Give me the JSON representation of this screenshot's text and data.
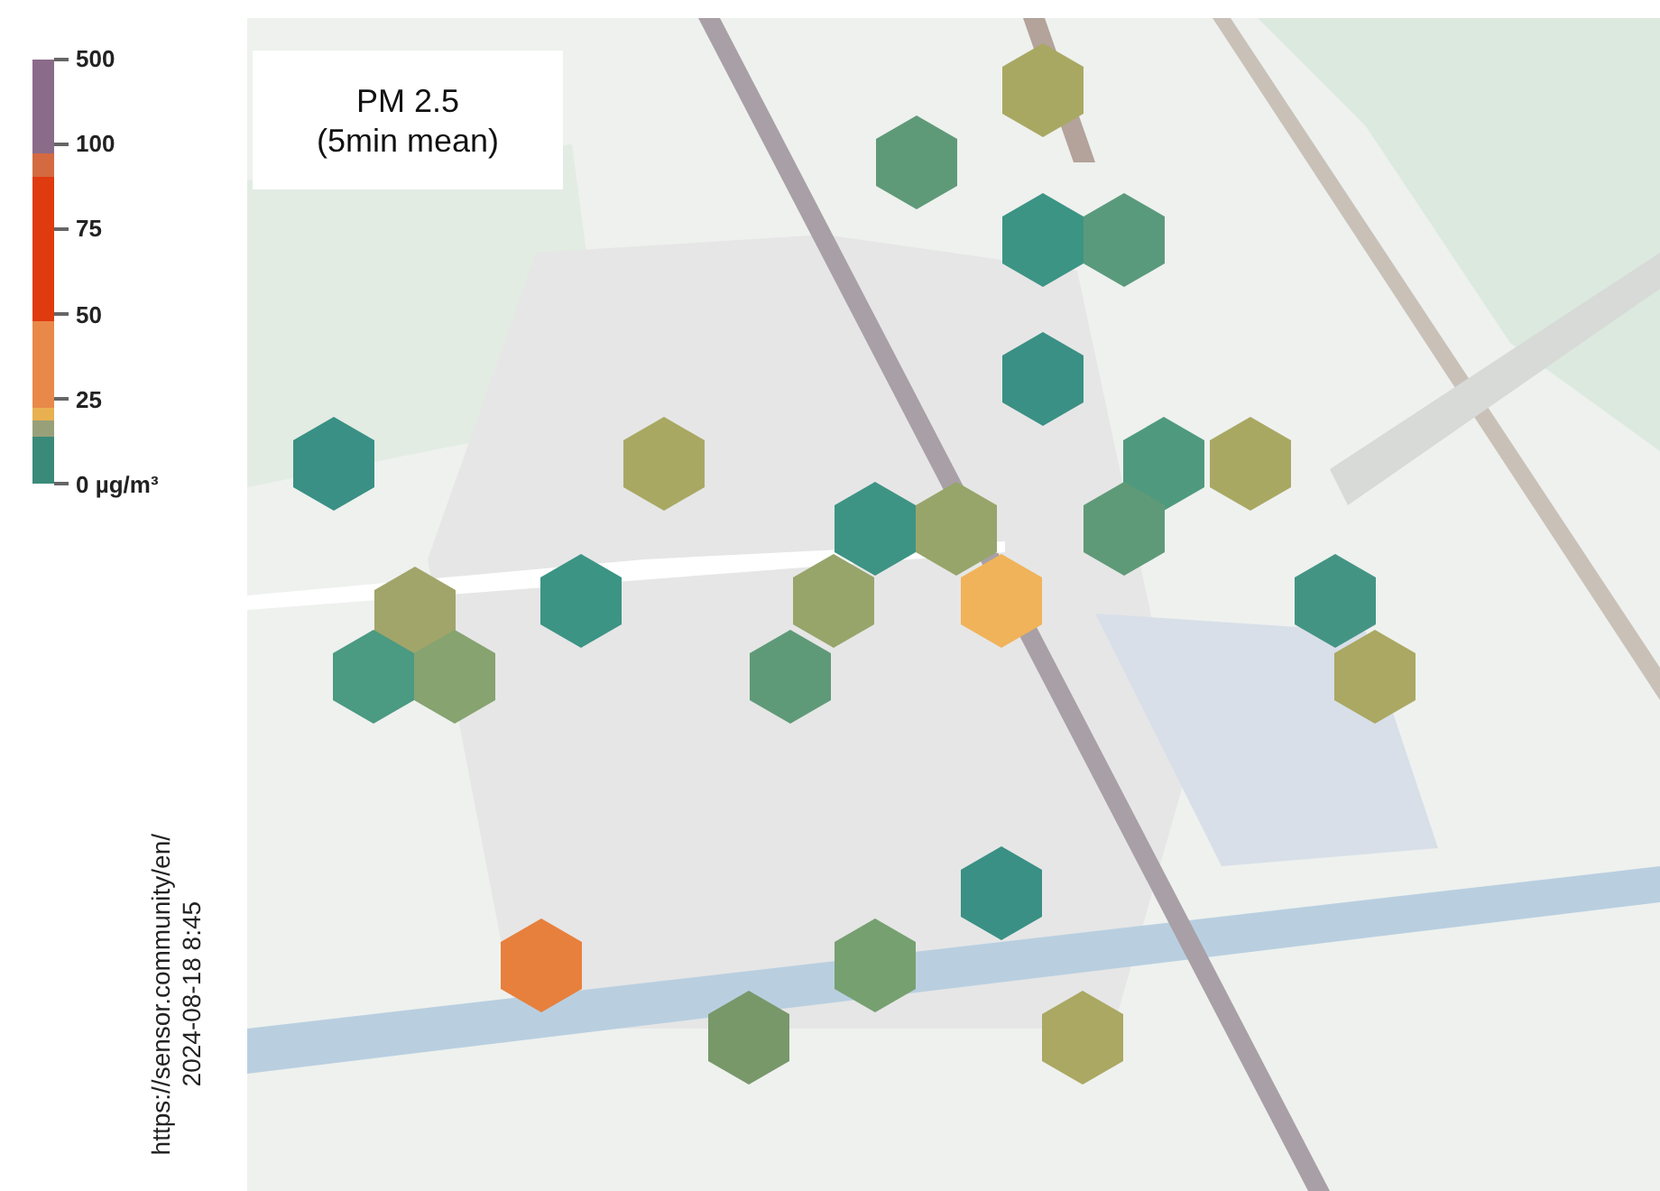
{
  "legend": {
    "segments": [
      {
        "color": "#8b6b8a"
      },
      {
        "color": "#d46a40"
      },
      {
        "color": "#e03a0f"
      },
      {
        "color": "#e8894a"
      },
      {
        "color": "#e9b050"
      },
      {
        "color": "#98a07a"
      },
      {
        "color": "#3a8a7a"
      }
    ],
    "ticks": [
      "500",
      "100",
      "75",
      "50",
      "25",
      "0 µg/m³"
    ]
  },
  "title": {
    "metric": "PM 2.5",
    "period": "(5min mean)"
  },
  "source": {
    "url": "https://sensor.community/en/",
    "timestamp": "2024-08-18 8:45"
  },
  "map": {
    "kind": "picture",
    "hexagons": [
      {
        "color": "#a9a863"
      },
      {
        "color": "#5f9a78"
      },
      {
        "color": "#3c9484"
      },
      {
        "color": "#5a9a7c"
      },
      {
        "color": "#3a9084"
      },
      {
        "color": "#3a9084"
      },
      {
        "color": "#a9a863"
      },
      {
        "color": "#4f9a7e"
      },
      {
        "color": "#a9a863"
      },
      {
        "color": "#3e9484"
      },
      {
        "color": "#97a56a"
      },
      {
        "color": "#5f9a78"
      },
      {
        "color": "#a1a56a"
      },
      {
        "color": "#3c9484"
      },
      {
        "color": "#97a56a"
      },
      {
        "color": "#f0b35a"
      },
      {
        "color": "#449484"
      },
      {
        "color": "#4b9a82"
      },
      {
        "color": "#86a370"
      },
      {
        "color": "#5f9a78"
      },
      {
        "color": "#aaa862"
      },
      {
        "color": "#3a9084"
      },
      {
        "color": "#76a070"
      },
      {
        "color": "#e7803c"
      },
      {
        "color": "#78986a"
      },
      {
        "color": "#aaa862"
      }
    ]
  }
}
